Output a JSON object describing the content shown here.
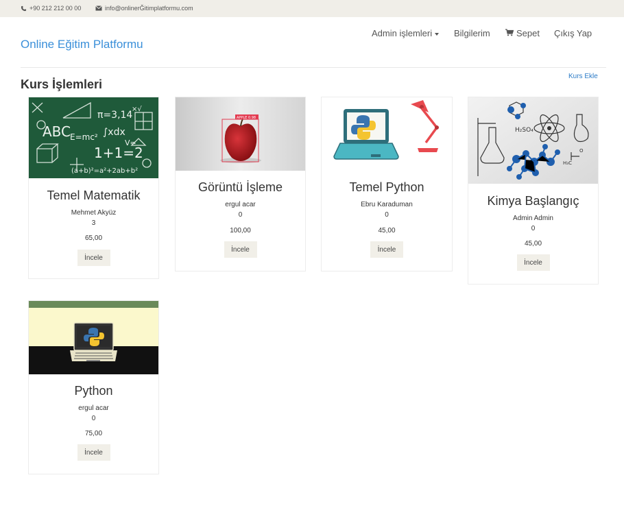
{
  "topbar": {
    "phone": "+90 212 212 00 00",
    "email": "info@onlinerĞitimplatformu.com",
    "phone_icon": "phone-icon",
    "email_icon": "envelope-icon"
  },
  "brand": "Online Eğitim Platformu",
  "nav": {
    "admin": "Admin işlemleri",
    "info": "Bilgilerim",
    "cart": "Sepet",
    "logout": "Çıkış Yap",
    "cart_icon": "cart-icon"
  },
  "page": {
    "title": "Kurs İşlemleri",
    "add_course": "Kurs Ekle"
  },
  "colors": {
    "brand": "#3a8fd9",
    "link": "#2a7ac6",
    "topbar_bg": "#f0eee8",
    "button_bg": "#f1efe8"
  },
  "courses": [
    {
      "title": "Temel Matematik",
      "instructor": "Mehmet Akyüz",
      "count": "3",
      "price": "65,00",
      "button": "İncele",
      "image": "chalkboard-math-image"
    },
    {
      "title": "Görüntü İşleme",
      "instructor": "ergul acar",
      "count": "0",
      "price": "100,00",
      "button": "İncele",
      "image": "apple-detection-image"
    },
    {
      "title": "Temel Python",
      "instructor": "Ebru Karaduman",
      "count": "0",
      "price": "45,00",
      "button": "İncele",
      "image": "python-laptop-lamp-image"
    },
    {
      "title": "Kimya Başlangıç",
      "instructor": "Admin Admin",
      "count": "0",
      "price": "45,00",
      "button": "İncele",
      "image": "chemistry-molecules-image"
    },
    {
      "title": "Python",
      "instructor": "ergul acar",
      "count": "0",
      "price": "75,00",
      "button": "İncele",
      "image": "python-laptop-image"
    }
  ],
  "image_labels": {
    "apple_tag": "APPLE 0.98"
  }
}
